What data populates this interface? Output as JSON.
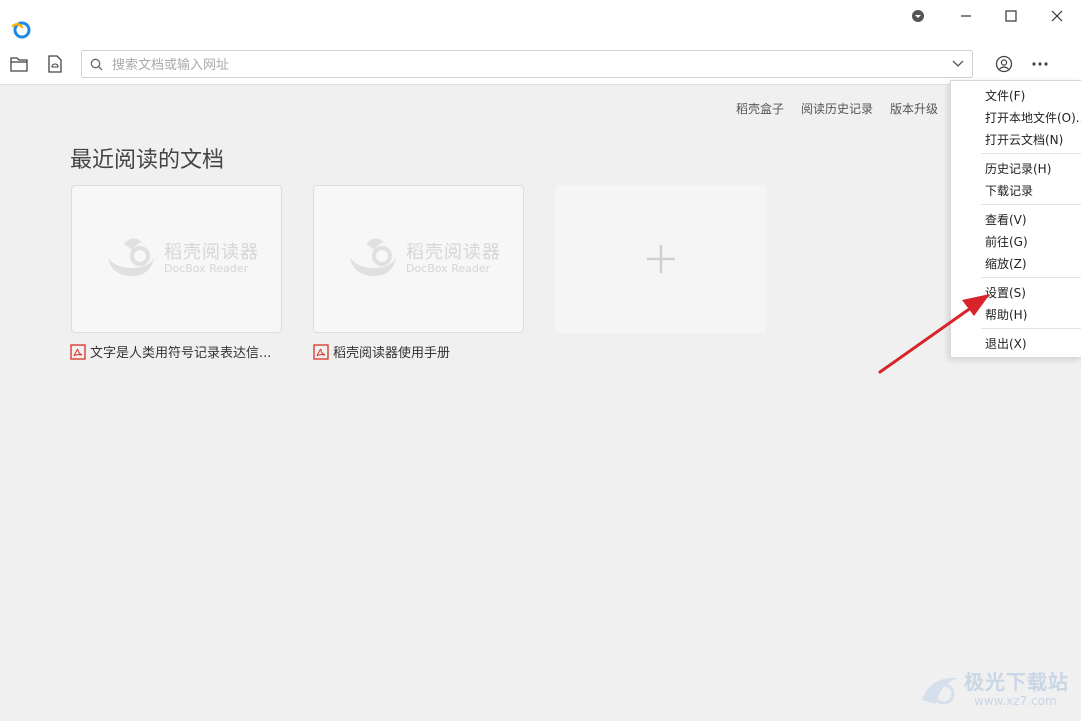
{
  "titlebar": {
    "icons": [
      "app-logo-icon",
      "dropdown-circle-icon",
      "minimize-icon",
      "maximize-icon",
      "close-icon"
    ]
  },
  "toolbar": {
    "search_placeholder": "搜索文档或输入网址",
    "icons": [
      "folder-icon",
      "cloud-doc-icon",
      "search-icon",
      "chevron-down-icon",
      "user-icon",
      "more-icon"
    ]
  },
  "top_links": [
    "稻壳盒子",
    "阅读历史记录",
    "版本升级"
  ],
  "recent": {
    "title": "最近阅读的文档",
    "watermark": {
      "cn": "稻壳阅读器",
      "en": "DocBox Reader"
    },
    "docs": [
      {
        "name": "文字是人类用符号记录表达信..."
      },
      {
        "name": "稻壳阅读器使用手册"
      }
    ],
    "add_label": "+"
  },
  "menu": {
    "groups": [
      [
        "文件(F)",
        "打开本地文件(O)...",
        "打开云文档(N)"
      ],
      [
        "历史记录(H)",
        "下载记录"
      ],
      [
        "查看(V)",
        "前往(G)",
        "缩放(Z)"
      ],
      [
        "设置(S)",
        "帮助(H)"
      ],
      [
        "退出(X)"
      ]
    ]
  },
  "watermark_brand": {
    "cn": "极光下载站",
    "url": "www.xz7.com"
  },
  "colors": {
    "accent": "#1e88e5",
    "pdf_red": "#d93025",
    "arrow_red": "#d8232a"
  }
}
